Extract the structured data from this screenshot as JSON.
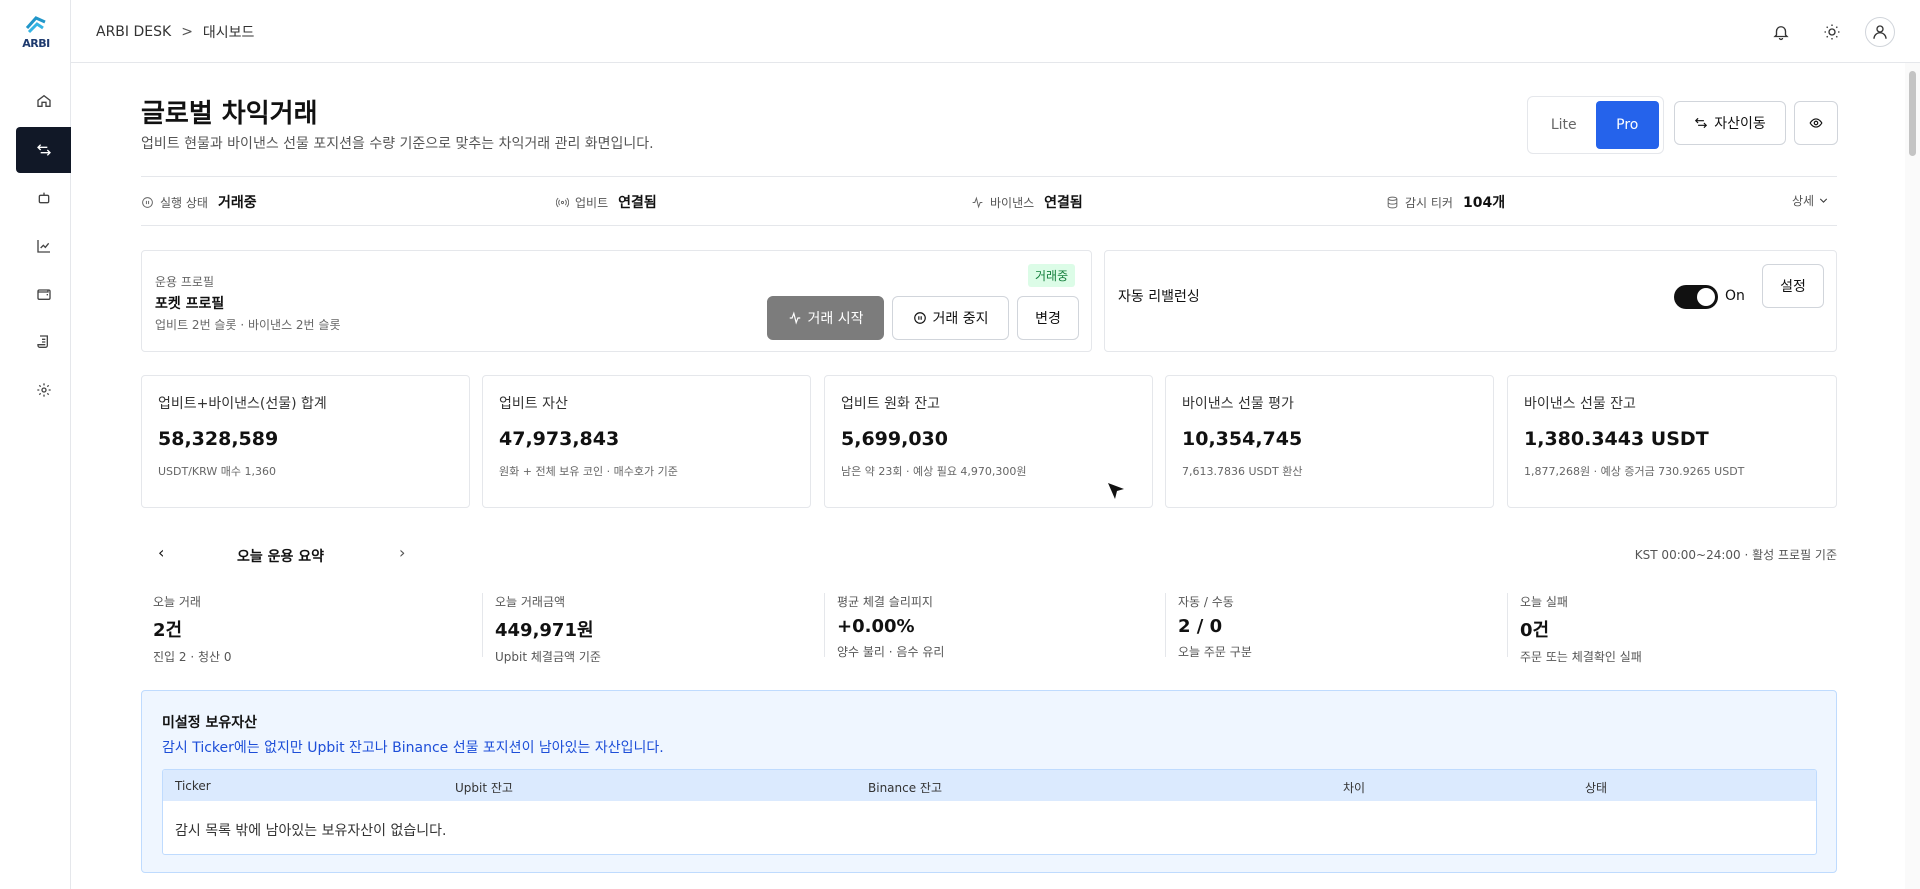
{
  "logo_text": "ARBI",
  "breadcrumb": {
    "root": "ARBI DESK",
    "separator": ">",
    "current": "대시보드"
  },
  "page": {
    "title": "글로벌 차익거래",
    "subtitle": "업비트 현물과 바이낸스 선물 포지션을 수량 기준으로 맞추는 차익거래 관리 화면입니다.",
    "mode_lite": "Lite",
    "mode_pro": "Pro",
    "transfer_label": "자산이동"
  },
  "status_bar": {
    "run_label": "실행 상태",
    "run_value": "거래중",
    "upbit_label": "업비트",
    "upbit_value": "연결됨",
    "binance_label": "바이낸스",
    "binance_value": "연결됨",
    "ticker_label": "감시 티커",
    "ticker_value": "104개",
    "detail_label": "상세"
  },
  "profile": {
    "label": "운용 프로필",
    "name": "포켓 프로필",
    "desc": "업비트 2번 슬롯 · 바이낸스 2번 슬롯",
    "badge": "거래중",
    "start": "거래 시작",
    "stop": "거래 중지",
    "change": "변경"
  },
  "rebalance": {
    "label": "자동 리밸런싱",
    "state": "On",
    "settings": "설정"
  },
  "stats": [
    {
      "title": "업비트+바이낸스(선물) 합계",
      "value": "58,328,589",
      "note": "USDT/KRW 매수 1,360"
    },
    {
      "title": "업비트 자산",
      "value": "47,973,843",
      "note": "원화 + 전체 보유 코인 · 매수호가 기준"
    },
    {
      "title": "업비트 원화 잔고",
      "value": "5,699,030",
      "note": "남은 약 23회 · 예상 필요 4,970,300원"
    },
    {
      "title": "바이낸스 선물 평가",
      "value": "10,354,745",
      "note": "7,613.7836 USDT 환산"
    },
    {
      "title": "바이낸스 선물 잔고",
      "value": "1,380.3443 USDT",
      "note": "1,877,268원 · 예상 증거금 730.9265 USDT"
    }
  ],
  "summary": {
    "title": "오늘 운용 요약",
    "range": "KST 00:00~24:00 · 활성 프로필 기준",
    "items": [
      {
        "title": "오늘 거래",
        "value": "2건",
        "note": "진입 2 · 청산 0"
      },
      {
        "title": "오늘 거래금액",
        "value": "449,971원",
        "note": "Upbit 체결금액 기준"
      },
      {
        "title": "평균 체결 슬리피지",
        "value": "+0.00%",
        "note": "양수 불리 · 음수 유리"
      },
      {
        "title": "자동 / 수동",
        "value": "2 / 0",
        "note": "오늘 주문 구분"
      },
      {
        "title": "오늘 실패",
        "value": "0건",
        "note": "주문 또는 체결확인 실패"
      }
    ]
  },
  "unassigned": {
    "title": "미설정 보유자산",
    "desc": "감시 Ticker에는 없지만 Upbit 잔고나 Binance 선물 포지션이 남아있는 자산입니다.",
    "columns": [
      "Ticker",
      "Upbit 잔고",
      "Binance 잔고",
      "차이",
      "상태"
    ],
    "empty": "감시 목록 밖에 남아있는 보유자산이 없습니다."
  },
  "colors": {
    "accent": "#2563eb",
    "active_nav": "#111827",
    "badge_bg": "#dcfce7",
    "badge_fg": "#15803d"
  }
}
